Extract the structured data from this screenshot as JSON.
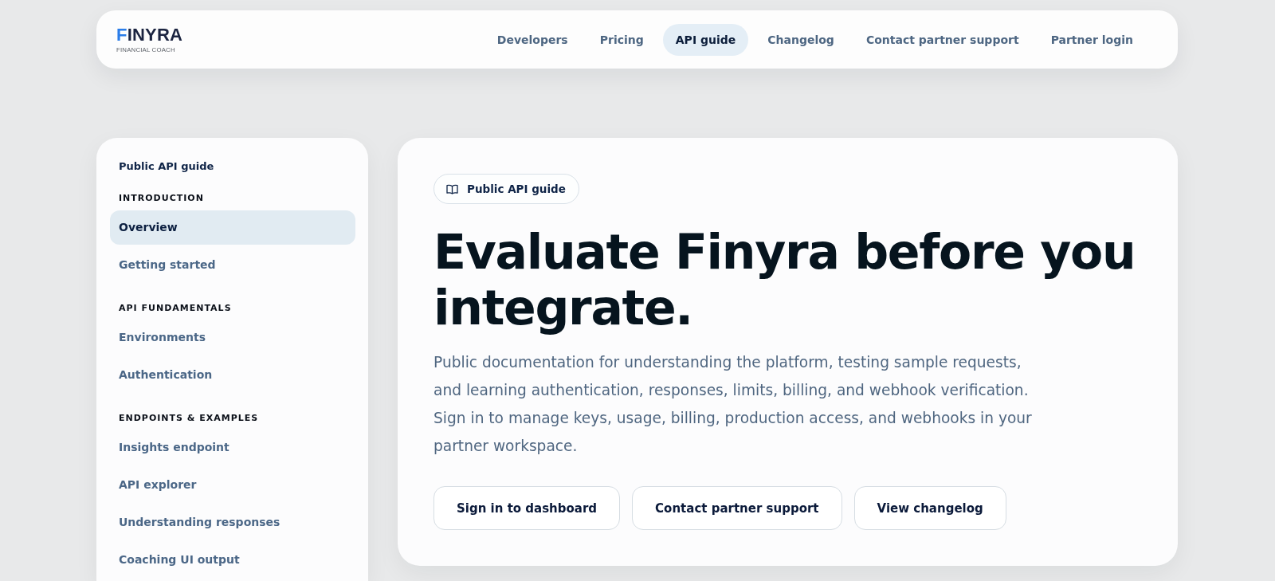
{
  "header": {
    "logo": {
      "name": "FINYRA",
      "tagline": "FINANCIAL COACH"
    },
    "nav": [
      {
        "label": "Developers",
        "selected": false
      },
      {
        "label": "Pricing",
        "selected": false
      },
      {
        "label": "API guide",
        "selected": true
      },
      {
        "label": "Changelog",
        "selected": false
      },
      {
        "label": "Contact partner support",
        "selected": false
      },
      {
        "label": "Partner login",
        "selected": false
      }
    ]
  },
  "sidebar": {
    "title": "Public API guide",
    "sections": [
      {
        "heading": "INTRODUCTION",
        "items": [
          {
            "label": "Overview",
            "selected": true
          },
          {
            "label": "Getting started",
            "selected": false
          }
        ]
      },
      {
        "heading": "API FUNDAMENTALS",
        "items": [
          {
            "label": "Environments",
            "selected": false
          },
          {
            "label": "Authentication",
            "selected": false
          }
        ]
      },
      {
        "heading": "ENDPOINTS & EXAMPLES",
        "items": [
          {
            "label": "Insights endpoint",
            "selected": false
          },
          {
            "label": "API explorer",
            "selected": false
          },
          {
            "label": "Understanding responses",
            "selected": false
          },
          {
            "label": "Coaching UI output",
            "selected": false
          }
        ]
      }
    ]
  },
  "main": {
    "badge": "Public API guide",
    "heading": "Evaluate Finyra before you integrate.",
    "description": "Public documentation for understanding the platform, testing sample requests, and learning authentication, responses, limits, billing, and webhook verification. Sign in to manage keys, usage, billing, production access, and webhooks in your partner workspace.",
    "buttons": [
      "Sign in to dashboard",
      "Contact partner support",
      "View changelog"
    ]
  }
}
